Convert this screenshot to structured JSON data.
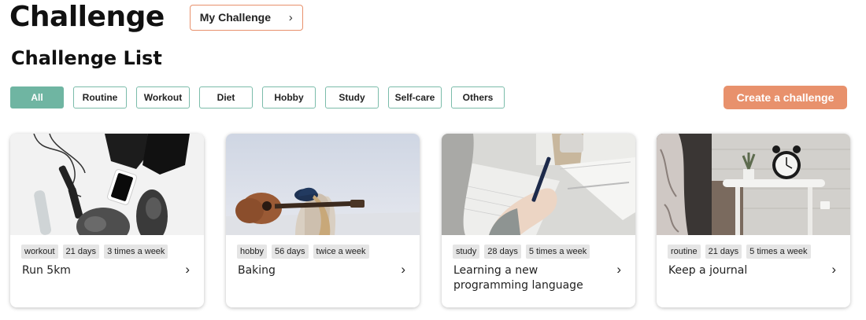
{
  "header": {
    "title": "Challenge",
    "my_challenge_label": "My Challenge",
    "chevron": "›"
  },
  "section_title": "Challenge List",
  "filters": [
    "All",
    "Routine",
    "Workout",
    "Diet",
    "Hobby",
    "Study",
    "Self-care",
    "Others"
  ],
  "active_filter": "All",
  "create_label": "Create a challenge",
  "cards": [
    {
      "tags": [
        "workout",
        "21 days",
        "3 times a week"
      ],
      "title": "Run 5km",
      "image": "workout-gear-image"
    },
    {
      "tags": [
        "hobby",
        "56 days",
        "twice a week"
      ],
      "title": "Baking",
      "image": "guitar-person-image"
    },
    {
      "tags": [
        "study",
        "28 days",
        "5 times a week"
      ],
      "title": "Learning a new programming language",
      "image": "writing-notebook-image"
    },
    {
      "tags": [
        "routine",
        "21 days",
        "5 times a week"
      ],
      "title": "Keep a journal",
      "image": "alarm-clock-bedside-image"
    }
  ],
  "colors": {
    "accent_green": "#6fb5a2",
    "accent_orange": "#e8916c"
  }
}
